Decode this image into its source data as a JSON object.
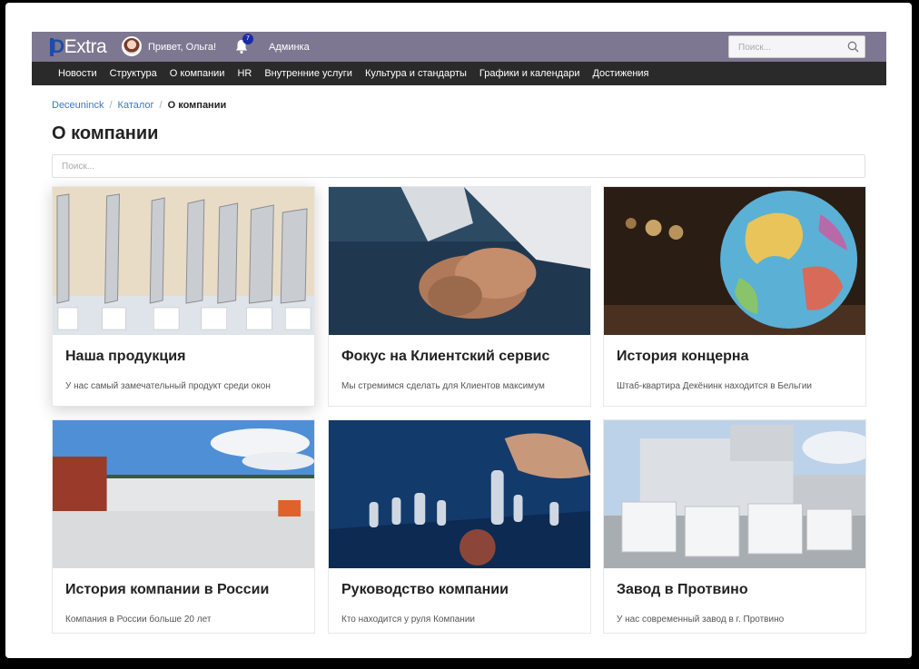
{
  "header": {
    "logo_d": "D",
    "logo_rest": "Extra",
    "greeting": "Привет, Ольга!",
    "notifications_count": "7",
    "admin_link": "Админка",
    "search_placeholder": "Поиск..."
  },
  "nav": [
    "Новости",
    "Структура",
    "О компании",
    "HR",
    "Внутренние услуги",
    "Культура и стандарты",
    "Графики и календари",
    "Достижения"
  ],
  "breadcrumb": {
    "items": [
      "Deceuninck",
      "Каталог"
    ],
    "current": "О компании"
  },
  "page": {
    "title": "О компании",
    "search_placeholder": "Поиск..."
  },
  "cards": [
    {
      "title": "Наша продукция",
      "desc": "У нас самый замечательный продукт среди окон"
    },
    {
      "title": "Фокус на Клиентский сервис",
      "desc": "Мы стремимся сделать для Клиентов максимум"
    },
    {
      "title": "История концерна",
      "desc": "Штаб-квартира Декёнинк находится в Бельгии"
    },
    {
      "title": "История компании в России",
      "desc": "Компания в России больше 20 лет"
    },
    {
      "title": "Руководство компании",
      "desc": "Кто находится у руля Компании"
    },
    {
      "title": "Завод в Протвино",
      "desc": "У нас современный завод в г. Протвино"
    }
  ],
  "colors": {
    "topbar": "#7d7791",
    "navbar": "#2a2a2a",
    "link": "#3a78c1"
  }
}
